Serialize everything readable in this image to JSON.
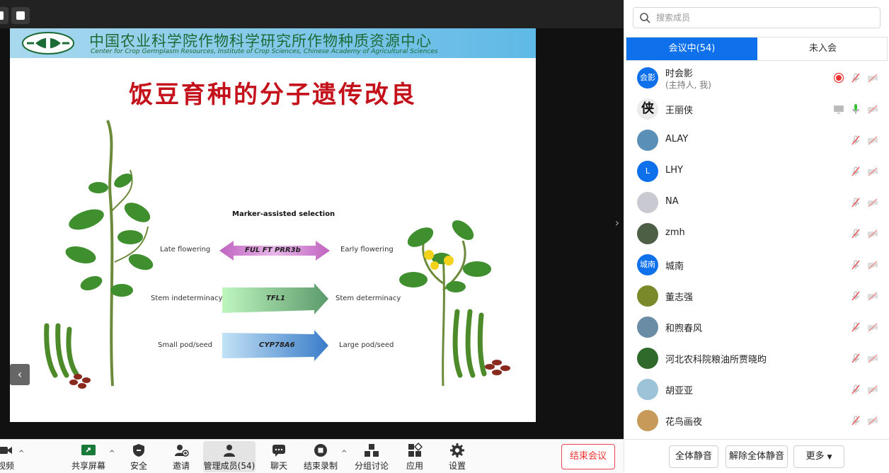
{
  "slide": {
    "header_cn": "中国农业科学院作物科学研究所作物种质资源中心",
    "header_en": "Center for Crop Germplasm Resources, Institute of Crop Sciences, Chinese Academy of Agricultural Sciences",
    "title": "饭豆育种的分子遗传改良",
    "diagram_title": "Marker-assisted selection",
    "rows": [
      {
        "left": "Late flowering",
        "genes": "FUL    FT    PRR3b",
        "right": "Early flowering"
      },
      {
        "left": "Stem indeterminacy",
        "genes": "TFL1",
        "right": "Stem determinacy"
      },
      {
        "left": "Small pod/seed",
        "genes": "CYP78A6",
        "right": "Large pod/seed"
      }
    ]
  },
  "toolbar": {
    "video_label": "视频",
    "share_label": "共享屏幕",
    "security_label": "安全",
    "invite_label": "邀请",
    "members_label": "管理成员(54)",
    "chat_label": "聊天",
    "record_label": "结束录制",
    "breakout_label": "分组讨论",
    "apps_label": "应用",
    "settings_label": "设置",
    "end_label": "结束会议"
  },
  "panel": {
    "search_placeholder": "搜索成员",
    "tab_in": "会议中(54)",
    "tab_out": "未入会",
    "members": [
      {
        "name": "时会影",
        "sub": "(主持人, 我)",
        "avatar_text": "会影",
        "avatar_color": "#0e71eb"
      },
      {
        "name": "王丽侠",
        "avatar_text": "侠",
        "avatar_color": "#ececec"
      },
      {
        "name": "ALAY",
        "avatar_text": "",
        "avatar_color": "#5a8fb8"
      },
      {
        "name": "LHY",
        "avatar_text": "L",
        "avatar_color": "#0e71eb"
      },
      {
        "name": "NA",
        "avatar_text": "",
        "avatar_color": "#c9c9d2"
      },
      {
        "name": "zmh",
        "avatar_text": "",
        "avatar_color": "#4d5f45"
      },
      {
        "name": "城南",
        "avatar_text": "城南",
        "avatar_color": "#0e71eb"
      },
      {
        "name": "董志强",
        "avatar_text": "",
        "avatar_color": "#7a8a2a"
      },
      {
        "name": "和煦春风",
        "avatar_text": "",
        "avatar_color": "#6a8ca5"
      },
      {
        "name": "河北农科院粮油所贾晓昀",
        "avatar_text": "",
        "avatar_color": "#2f6a2a"
      },
      {
        "name": "胡亚亚",
        "avatar_text": "",
        "avatar_color": "#9cc3d8"
      },
      {
        "name": "花鸟画夜",
        "avatar_text": "",
        "avatar_color": "#c89a5a"
      }
    ],
    "mute_all": "全体静音",
    "unmute_all": "解除全体静音",
    "more": "更多"
  },
  "colors": {
    "accent": "#0e71eb",
    "end": "#e33333",
    "title_red": "#c4121c"
  }
}
